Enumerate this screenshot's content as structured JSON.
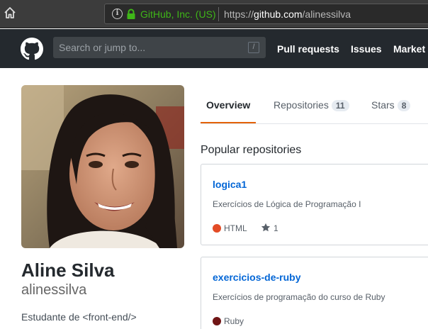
{
  "browser": {
    "cert_name": "GitHub, Inc. (US)",
    "url_prefix": "https://",
    "url_domain": "github.com",
    "url_path": "/alinessilva",
    "icons": {
      "home": "home-icon",
      "info": "info-icon",
      "lock": "lock-icon"
    },
    "cert_color": "#3fb618"
  },
  "header": {
    "logo": "github-octocat-icon",
    "search_placeholder": "Search or jump to...",
    "search_shortcut": "/",
    "nav": [
      "Pull requests",
      "Issues",
      "Market"
    ]
  },
  "profile": {
    "name": "Aline Silva",
    "username": "alinessilva",
    "bio": "Estudante de <front-end/>"
  },
  "tabs": [
    {
      "label": "Overview",
      "count": null,
      "active": true
    },
    {
      "label": "Repositories",
      "count": "11",
      "active": false
    },
    {
      "label": "Stars",
      "count": "8",
      "active": false
    }
  ],
  "popular": {
    "heading": "Popular repositories",
    "repos": [
      {
        "name": "logica1",
        "description": "Exercícios de Lógica de Programação I",
        "language": "HTML",
        "language_color": "#e34c26",
        "stars": "1"
      },
      {
        "name": "exercicios-de-ruby",
        "description": "Exercícios de programação do curso de Ruby",
        "language": "Ruby",
        "language_color": "#701516",
        "stars": ""
      }
    ]
  },
  "colors": {
    "header_bg": "#24292e",
    "tab_accent": "#e36209",
    "link": "#0366d6"
  }
}
